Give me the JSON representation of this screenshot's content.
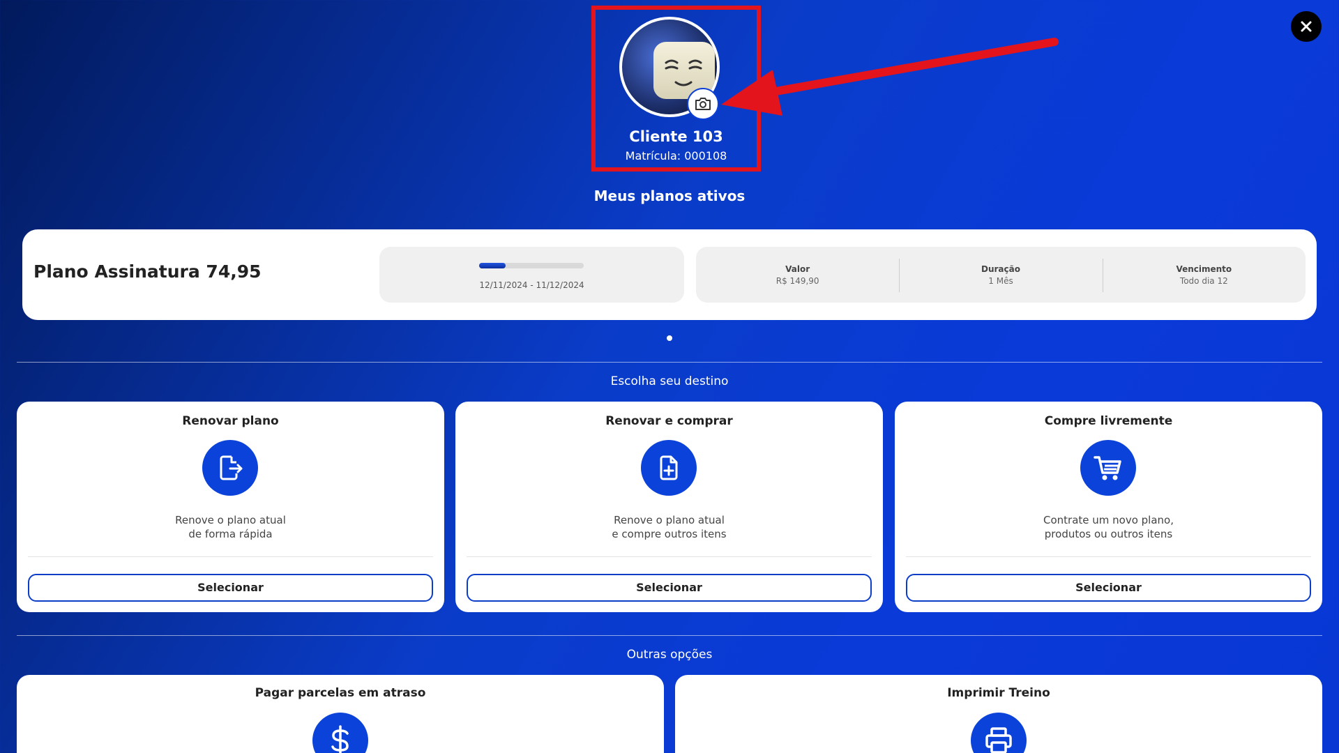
{
  "profile": {
    "name": "Cliente 103",
    "registration": "Matrícula: 000108",
    "avatar_icon": "avatar-cartoon-face",
    "camera_icon": "camera-icon"
  },
  "colors": {
    "accent": "#0b42d9",
    "highlight_box": "#e3141b",
    "close_bg": "#000000"
  },
  "active_plans": {
    "title": "Meus planos ativos",
    "plan": {
      "name": "Plano Assinatura 74,95",
      "progress": 0.25,
      "date_range": "12/11/2024 - 11/12/2024",
      "details": [
        {
          "label": "Valor",
          "value": "R$ 149,90"
        },
        {
          "label": "Duração",
          "value": "1 Mês"
        },
        {
          "label": "Vencimento",
          "value": "Todo dia 12"
        }
      ]
    }
  },
  "destinations": {
    "title": "Escolha seu destino",
    "cards": [
      {
        "title": "Renovar plano",
        "icon": "file-export-icon",
        "desc_line1": "Renove o plano atual",
        "desc_line2": "de forma rápida",
        "button": "Selecionar"
      },
      {
        "title": "Renovar e comprar",
        "icon": "file-plus-icon",
        "desc_line1": "Renove o plano atual",
        "desc_line2": "e compre outros itens",
        "button": "Selecionar"
      },
      {
        "title": "Compre livremente",
        "icon": "shopping-cart-icon",
        "desc_line1": "Contrate um novo plano,",
        "desc_line2": "produtos ou outros itens",
        "button": "Selecionar"
      }
    ]
  },
  "other_options": {
    "title": "Outras opções",
    "cards": [
      {
        "title": "Pagar parcelas em atraso",
        "icon": "dollar-icon"
      },
      {
        "title": "Imprimir Treino",
        "icon": "printer-icon"
      }
    ]
  }
}
